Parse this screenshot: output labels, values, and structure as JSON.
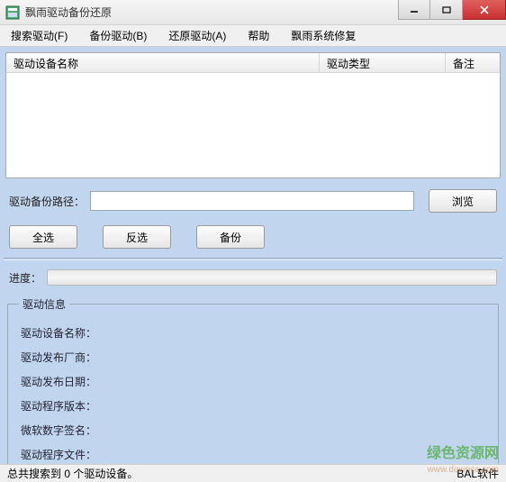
{
  "window": {
    "title": "飘雨驱动备份还原"
  },
  "menu": {
    "search": "搜索驱动(F)",
    "backup": "备份驱动(B)",
    "restore": "还原驱动(A)",
    "help": "帮助",
    "sysrepair": "飘雨系统修复"
  },
  "list": {
    "col_name": "驱动设备名称",
    "col_type": "驱动类型",
    "col_note": "备注"
  },
  "path": {
    "label": "驱动备份路径：",
    "value": "",
    "browse": "浏览"
  },
  "buttons": {
    "select_all": "全选",
    "invert": "反选",
    "backup": "备份"
  },
  "progress": {
    "label": "进度："
  },
  "info": {
    "legend": "驱动信息",
    "device_name": "驱动设备名称：",
    "vendor": "驱动发布厂商：",
    "date": "驱动发布日期：",
    "version": "驱动程序版本：",
    "signature": "微软数字签名：",
    "file": "驱动程序文件："
  },
  "status": {
    "left": "总共搜索到 0 个驱动设备。",
    "right": "BAL软件"
  },
  "watermark": {
    "main": "绿色资源网",
    "sub": "www.downcc.com"
  }
}
